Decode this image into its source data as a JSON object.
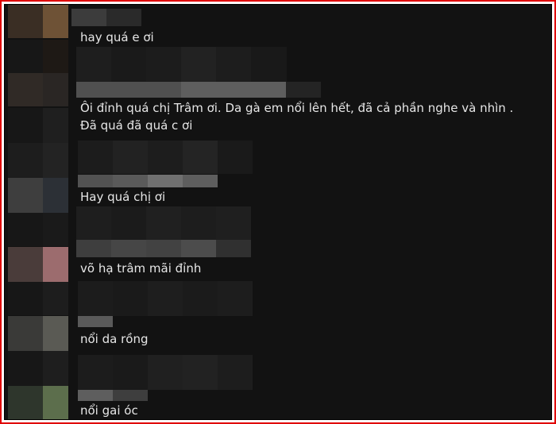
{
  "comments": [
    {
      "text": "hay quá e ơi"
    },
    {
      "text": "Ôi đỉnh quá chị Trâm ơi. Da gà em nổi lên hết, đã cả phần nghe và nhìn . Đã quá đã quá c ơi"
    },
    {
      "text": "Hay quá chị ơi"
    },
    {
      "text": "võ hạ trâm mãi đỉnh"
    },
    {
      "text": "nổi da rồng"
    },
    {
      "text": "nổi gai óc"
    }
  ],
  "colors": {
    "frame_border": "#e00000",
    "background": "#121212",
    "text": "#e6e6e6"
  }
}
